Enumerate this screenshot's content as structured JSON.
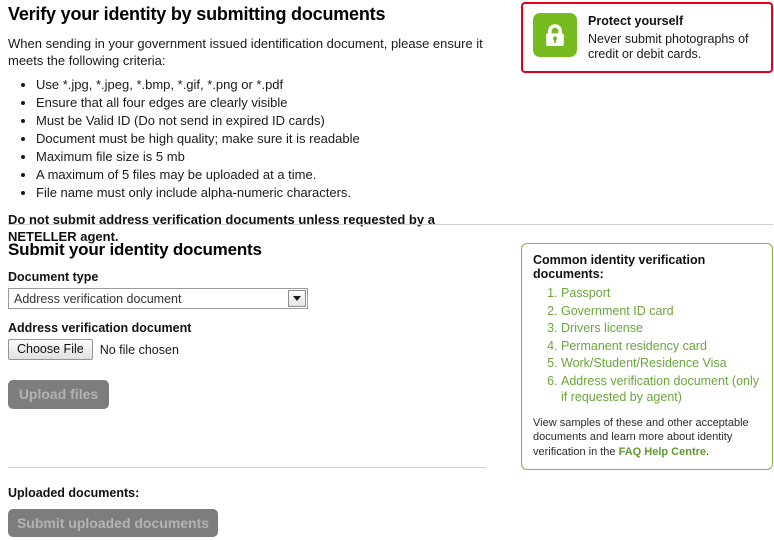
{
  "header": {
    "title": "Verify your identity by submitting documents",
    "intro": "When sending in your government issued identification document, please ensure it meets the following criteria:",
    "criteria": [
      "Use *.jpg, *.jpeg, *.bmp, *.gif, *.png or *.pdf",
      "Ensure that all four edges are clearly visible",
      "Must be Valid ID (Do not send in expired ID cards)",
      "Document must be high quality; make sure it is readable",
      "Maximum file size is 5 mb",
      "A maximum of 5 files may be uploaded at a time.",
      "File name must only include alpha-numeric characters."
    ],
    "warning": "Do not submit address verification documents unless requested by a NETELLER agent."
  },
  "protect_box": {
    "icon": "padlock-icon",
    "title": "Protect yourself",
    "body": "Never submit photographs of credit or debit cards.",
    "border_color": "#e2001a",
    "badge_color": "#76bc21"
  },
  "form": {
    "section_title": "Submit your identity documents",
    "document_type_label": "Document type",
    "document_type_value": "Address verification document",
    "document_type_options": [
      "Address verification document"
    ],
    "file_field_label": "Address verification document",
    "choose_file_label": "Choose File",
    "file_status": "No file chosen",
    "upload_button_label": "Upload files",
    "upload_button_disabled": true
  },
  "uploaded": {
    "label": "Uploaded documents:",
    "submit_button_label": "Submit uploaded documents",
    "submit_button_disabled": true
  },
  "docs_box": {
    "title": "Common identity verification documents:",
    "items": [
      "Passport",
      "Government ID card",
      "Drivers license",
      "Permanent residency card",
      "Work/Student/Residence Visa",
      "Address verification document (only if requested by agent)"
    ],
    "note_before": "View samples of these and other acceptable documents and learn more about identity verification in the ",
    "note_link": "FAQ Help Centre",
    "note_after": ".",
    "border_color": "#7eb53f",
    "list_color": "#6aa63c"
  }
}
